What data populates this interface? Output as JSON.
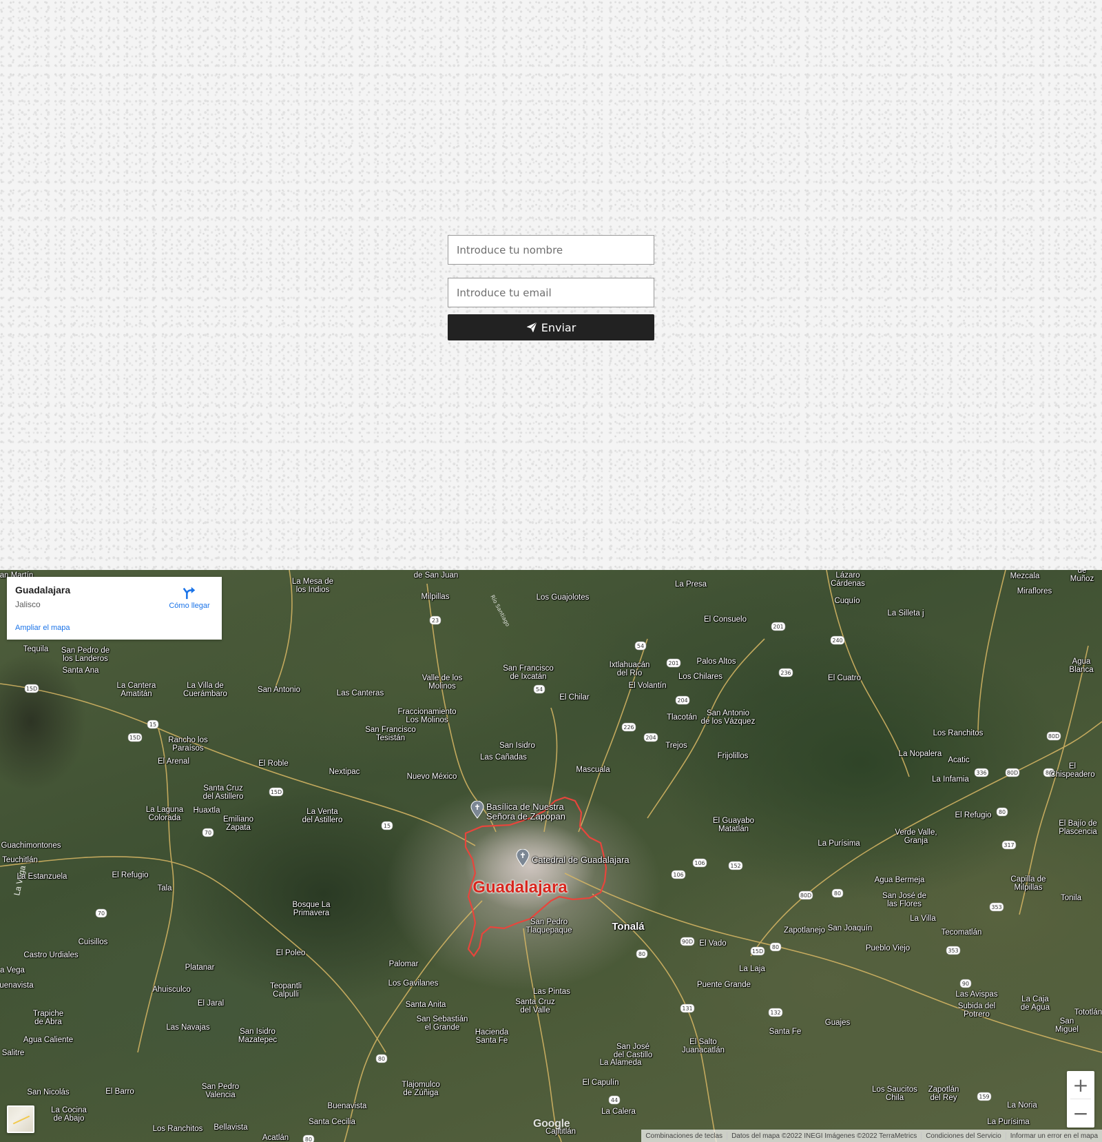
{
  "form": {
    "name_placeholder": "Introduce tu nombre",
    "email_placeholder": "Introduce tu email",
    "submit_label": "Enviar",
    "submit_icon": "paper-plane-icon"
  },
  "map": {
    "info_card": {
      "title": "Guadalajara",
      "subtitle": "Jalisco",
      "directions_label": "Cómo llegar",
      "enlarge_label": "Ampliar el mapa"
    },
    "city_label": "Guadalajara",
    "town_labels": {
      "tonala": "Tonalá"
    },
    "poi": {
      "basilica": "Basílica de Nuestra\nSeñora de Zapopan",
      "catedral": "Catedral de Guadalajara"
    },
    "places": {
      "p1": "La Mesa de\nlos Indios",
      "p2": "Milpillas",
      "p3": "Los Guajolotes",
      "p4": "La Presa",
      "p5": "El Consuelo",
      "p6": "Cuquío",
      "p7": "La Silleta j",
      "p8": "Mezcala",
      "p9": "Miraflores",
      "p10": "Lázaro\nCárdenas",
      "p11": "Tequila",
      "p12": "San Pedro de\nlos Landeros",
      "p13": "Santa Ana",
      "p14": "La Cantera\nAmatitán",
      "p15": "La Villa de\nCuerámbaro",
      "p16": "San Antonio",
      "p17": "Las Canteras",
      "p18": "Valle de los\nMolinos",
      "p19": "San Francisco\nde Ixcatán",
      "p20": "Ixtlahuacán\ndel Río",
      "p21": "Palos Altos",
      "p22": "Los Chilares",
      "p23": "El Cuatro",
      "p24": "Agua Blanca",
      "p25": "El Chilar",
      "p26": "El Volantín",
      "p27": "Fraccionamiento\nLos Molinos",
      "p28": "San Francisco\nTesistán",
      "p29": "Tlacotán",
      "p30": "San Antonio\nde los Vázquez",
      "p31": "Los Ranchitos",
      "p32": "Rancho los\nParaísos",
      "p33": "El Arenal",
      "p34": "El Roble",
      "p35": "San Isidro",
      "p36": "Las Cañadas",
      "p37": "Trejos",
      "p38": "Frijolillos",
      "p39": "La Nopalera",
      "p40": "Acatic",
      "p41": "El Chispeadero",
      "p42": "Nextipac",
      "p43": "Nuevo México",
      "p44": "Mascuala",
      "p45": "La Infamia",
      "p46": "Santa Cruz\ndel Astillero",
      "p47": "La Laguna\nColorada",
      "p48": "Huaxtla",
      "p49": "Emiliano\nZapata",
      "p50": "La Venta\ndel Astillero",
      "p51": "El Guayabo\nMatatlán",
      "p52": "El Refugio",
      "p53": "El Bajío de\nPlascencia",
      "p54": "Guachimontones",
      "p55": "Teuchitlán",
      "p56": "La Estanzuela",
      "p57": "El Refugio",
      "p58": "Tala",
      "p59": "Verde Valle,\nGranja",
      "p60": "La Purísima",
      "p61": "Agua Bermeja",
      "p62": "San José de\nlas Flores",
      "p63": "Capilla de\nMilpillas",
      "p64": "Bosque La\nPrimavera",
      "p65": "Tonila",
      "p66": "La Villa",
      "p67": "San Pedro\nTlaquepaque",
      "p68": "Zapotlanejo",
      "p69": "San Joaquín",
      "p70": "Tecomatlán",
      "p71": "Cuisillos",
      "p72": "Castro Urdiales",
      "p73": "El Poleo",
      "p74": "Platanar",
      "p75": "Palomar",
      "p76": "El Vado",
      "p77": "Pueblo Viejo",
      "p78": "a Vega",
      "p79": "uenavista",
      "p80": "Ahuisculco",
      "p81": "Teopantli\nCalpulli",
      "p82": "Los Gavilanes",
      "p83": "La Laja",
      "p84": "Puente Grande",
      "p85": "Las Pintas",
      "p86": "Santa Cruz\ndel Valle",
      "p87": "Santa Anita",
      "p88": "Las Avispas",
      "p89": "La Caja\nde Agua",
      "p90": "Tototlán",
      "p91": "Subida del\nPotrero",
      "p92": "Trapiche\nde Abra",
      "p93": "El Jaral",
      "p94": "San Sebastián\nel Grande",
      "p95": "Hacienda\nSanta Fe",
      "p96": "Santa Fe",
      "p97": "Guajes",
      "p98": "San Miguel",
      "p99": "Agua Caliente",
      "p100": "Las Navajas",
      "p101": "San Isidro\nMazatepec",
      "p102": "El Salto\nJuanacatlán",
      "p103": "San José\ndel Castillo",
      "p104": "Salitre",
      "p105": "La Alameda",
      "p106": "Tlajomulco\nde Zúñiga",
      "p107": "El Capulín",
      "p108": "San Nicolás",
      "p109": "El Barro",
      "p110": "San Pedro\nValencia",
      "p111": "Buenavista",
      "p112": "Los Saucitos\nChila",
      "p113": "Zapotlán\ndel Rey",
      "p114": "La Noria",
      "p115": "La Cocina\nde Abajo",
      "p116": "Los Ranchitos",
      "p117": "Bellavista",
      "p118": "Santa Cecilia",
      "p119": "La Calera",
      "p120": "Cajititlán",
      "p121": "La Purísima",
      "p122": "Acatlán",
      "p123": "de San Juan",
      "p124": "an Martín",
      "p125": "de Muñoz"
    },
    "zoom_in": "+",
    "zoom_out": "−",
    "google_logo": "Google",
    "attribution": {
      "shortcuts": "Combinaciones de teclas",
      "data": "Datos del mapa ©2022 INEGI Imágenes ©2022 TerraMetrics",
      "terms": "Condiciones del Servicio",
      "report": "Informar un error en el mapa"
    },
    "colors": {
      "boundary": "#e8453c",
      "link": "#1a73e8",
      "road": "#d9b865"
    }
  }
}
